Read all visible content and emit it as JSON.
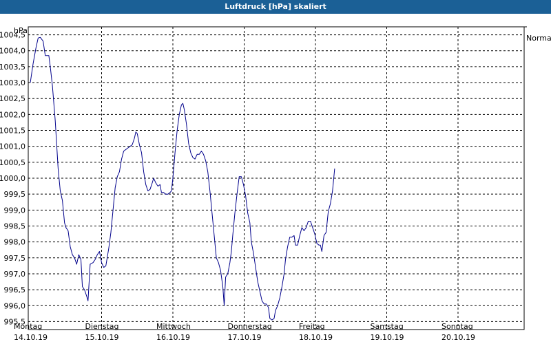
{
  "window": {
    "title": "Luftdruck [hPa] skaliert"
  },
  "chart_data": {
    "type": "line",
    "title": "Luftdruck [hPa] skaliert",
    "ylabel": "hPa",
    "ylim": [
      995.25,
      1004.75
    ],
    "xlim": [
      0,
      7
    ],
    "yticks": [
      "995,5",
      "996,0",
      "996,5",
      "997,0",
      "997,5",
      "998,0",
      "998,5",
      "999,0",
      "999,5",
      "1000,0",
      "1000,5",
      "1001,0",
      "1001,5",
      "1002,0",
      "1002,5",
      "1003,0",
      "1003,5",
      "1004,0",
      "1004,5"
    ],
    "x_categories": [
      {
        "day": "Montag",
        "date": "14.10.19"
      },
      {
        "day": "Dienstag",
        "date": "15.10.19"
      },
      {
        "day": "Mittwoch",
        "date": "16.10.19"
      },
      {
        "day": "Donnerstag",
        "date": "17.10.19"
      },
      {
        "day": "Freitag",
        "date": "18.10.19"
      },
      {
        "day": "Samstag",
        "date": "19.10.19"
      },
      {
        "day": "Sonntag",
        "date": "20.10.19"
      }
    ],
    "reference_line": {
      "label": "Normal",
      "value": 1004.75
    },
    "grid": true,
    "series": [
      {
        "color": "#00008b",
        "points": [
          [
            0.0,
            1003.0
          ],
          [
            0.04,
            1003.6
          ],
          [
            0.08,
            1004.1
          ],
          [
            0.11,
            1004.4
          ],
          [
            0.14,
            1004.42
          ],
          [
            0.18,
            1004.3
          ],
          [
            0.21,
            1003.85
          ],
          [
            0.24,
            1003.85
          ],
          [
            0.26,
            1003.85
          ],
          [
            0.28,
            1003.5
          ],
          [
            0.31,
            1002.9
          ],
          [
            0.35,
            1001.8
          ],
          [
            0.39,
            1000.3
          ],
          [
            0.42,
            999.6
          ],
          [
            0.45,
            999.3
          ],
          [
            0.48,
            998.6
          ],
          [
            0.5,
            998.45
          ],
          [
            0.53,
            998.35
          ],
          [
            0.56,
            997.85
          ],
          [
            0.59,
            997.6
          ],
          [
            0.62,
            997.5
          ],
          [
            0.65,
            997.3
          ],
          [
            0.68,
            997.6
          ],
          [
            0.71,
            997.45
          ],
          [
            0.73,
            996.6
          ],
          [
            0.76,
            996.5
          ],
          [
            0.79,
            996.3
          ],
          [
            0.81,
            996.15
          ],
          [
            0.84,
            997.3
          ],
          [
            0.88,
            997.35
          ],
          [
            0.91,
            997.45
          ],
          [
            0.94,
            997.6
          ],
          [
            0.97,
            997.7
          ],
          [
            1.0,
            997.35
          ],
          [
            1.03,
            997.2
          ],
          [
            1.06,
            997.25
          ],
          [
            1.1,
            997.8
          ],
          [
            1.13,
            998.3
          ],
          [
            1.16,
            999.0
          ],
          [
            1.19,
            999.7
          ],
          [
            1.22,
            1000.05
          ],
          [
            1.25,
            1000.2
          ],
          [
            1.28,
            1000.6
          ],
          [
            1.31,
            1000.85
          ],
          [
            1.34,
            1000.9
          ],
          [
            1.37,
            1000.95
          ],
          [
            1.4,
            1001.0
          ],
          [
            1.43,
            1001.05
          ],
          [
            1.46,
            1001.25
          ],
          [
            1.48,
            1001.45
          ],
          [
            1.5,
            1001.4
          ],
          [
            1.53,
            1001.05
          ],
          [
            1.56,
            1000.8
          ],
          [
            1.59,
            1000.2
          ],
          [
            1.62,
            999.8
          ],
          [
            1.65,
            999.6
          ],
          [
            1.68,
            999.65
          ],
          [
            1.71,
            999.85
          ],
          [
            1.73,
            1000.0
          ],
          [
            1.76,
            999.85
          ],
          [
            1.79,
            999.75
          ],
          [
            1.82,
            999.8
          ],
          [
            1.84,
            999.55
          ],
          [
            1.87,
            999.55
          ],
          [
            1.9,
            999.5
          ],
          [
            1.93,
            999.5
          ],
          [
            1.96,
            999.55
          ],
          [
            1.98,
            999.6
          ],
          [
            2.0,
            1000.0
          ],
          [
            2.03,
            1000.8
          ],
          [
            2.06,
            1001.5
          ],
          [
            2.09,
            1002.0
          ],
          [
            2.12,
            1002.3
          ],
          [
            2.14,
            1002.35
          ],
          [
            2.16,
            1002.15
          ],
          [
            2.19,
            1001.7
          ],
          [
            2.22,
            1001.1
          ],
          [
            2.25,
            1000.8
          ],
          [
            2.28,
            1000.65
          ],
          [
            2.31,
            1000.6
          ],
          [
            2.34,
            1000.75
          ],
          [
            2.37,
            1000.75
          ],
          [
            2.4,
            1000.85
          ],
          [
            2.43,
            1000.75
          ],
          [
            2.46,
            1000.55
          ],
          [
            2.49,
            1000.2
          ],
          [
            2.52,
            999.6
          ],
          [
            2.55,
            998.9
          ],
          [
            2.58,
            998.2
          ],
          [
            2.61,
            997.5
          ],
          [
            2.64,
            997.35
          ],
          [
            2.67,
            997.1
          ],
          [
            2.7,
            996.6
          ],
          [
            2.72,
            996.0
          ],
          [
            2.74,
            996.9
          ],
          [
            2.77,
            997.0
          ],
          [
            2.8,
            997.35
          ],
          [
            2.82,
            997.7
          ],
          [
            2.84,
            998.2
          ],
          [
            2.87,
            998.9
          ],
          [
            2.9,
            999.5
          ],
          [
            2.93,
            1000.05
          ],
          [
            2.96,
            1000.05
          ],
          [
            2.99,
            999.8
          ],
          [
            3.02,
            999.45
          ],
          [
            3.05,
            998.9
          ],
          [
            3.08,
            998.6
          ],
          [
            3.1,
            998.0
          ],
          [
            3.13,
            997.65
          ],
          [
            3.16,
            997.2
          ],
          [
            3.19,
            996.75
          ],
          [
            3.22,
            996.45
          ],
          [
            3.25,
            996.15
          ],
          [
            3.28,
            996.05
          ],
          [
            3.31,
            996.05
          ],
          [
            3.34,
            995.95
          ],
          [
            3.36,
            995.6
          ],
          [
            3.39,
            995.55
          ],
          [
            3.42,
            995.6
          ],
          [
            3.44,
            995.85
          ],
          [
            3.47,
            996.0
          ],
          [
            3.5,
            996.25
          ],
          [
            3.53,
            996.6
          ],
          [
            3.56,
            997.0
          ],
          [
            3.58,
            997.45
          ],
          [
            3.61,
            997.85
          ],
          [
            3.64,
            998.15
          ],
          [
            3.67,
            998.15
          ],
          [
            3.7,
            998.2
          ],
          [
            3.72,
            997.9
          ],
          [
            3.75,
            997.9
          ],
          [
            3.78,
            998.2
          ],
          [
            3.81,
            998.45
          ],
          [
            3.84,
            998.35
          ],
          [
            3.87,
            998.45
          ],
          [
            3.9,
            998.65
          ],
          [
            3.93,
            998.65
          ],
          [
            3.96,
            998.45
          ],
          [
            3.99,
            998.25
          ],
          [
            4.02,
            997.95
          ],
          [
            4.05,
            997.9
          ],
          [
            4.07,
            997.9
          ],
          [
            4.09,
            997.7
          ],
          [
            4.12,
            998.2
          ],
          [
            4.15,
            998.3
          ],
          [
            4.18,
            998.95
          ],
          [
            4.21,
            999.2
          ],
          [
            4.24,
            999.6
          ],
          [
            4.27,
            1000.3
          ]
        ]
      }
    ]
  }
}
